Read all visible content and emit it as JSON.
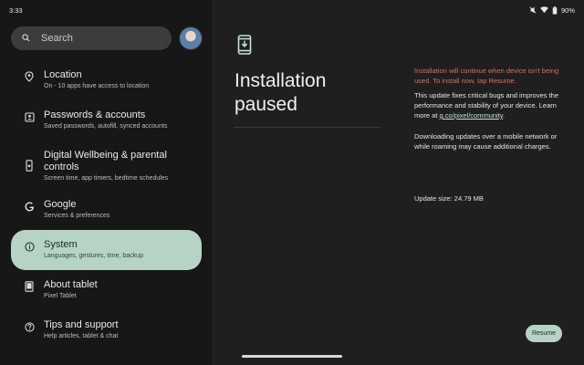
{
  "status_bar": {
    "time": "3:33",
    "battery": "90%",
    "icons": [
      "mute-icon",
      "wifi-icon",
      "battery-icon"
    ]
  },
  "search": {
    "placeholder": "Search"
  },
  "sidebar": {
    "items": [
      {
        "title": "Location",
        "subtitle": "On - 10 apps have access to location",
        "icon": "location-pin-icon"
      },
      {
        "title": "Passwords & accounts",
        "subtitle": "Saved passwords, autofill, synced accounts",
        "icon": "account-box-icon"
      },
      {
        "title": "Digital Wellbeing & parental controls",
        "subtitle": "Screen time, app timers, bedtime schedules",
        "icon": "wellbeing-icon"
      },
      {
        "title": "Google",
        "subtitle": "Services & preferences",
        "icon": "google-icon"
      },
      {
        "title": "System",
        "subtitle": "Languages, gestures, time, backup",
        "icon": "info-icon",
        "selected": true
      },
      {
        "title": "About tablet",
        "subtitle": "Pixel Tablet",
        "icon": "tablet-icon"
      },
      {
        "title": "Tips and support",
        "subtitle": "Help articles, tablet & chat",
        "icon": "help-icon"
      }
    ]
  },
  "main": {
    "title": "Installation paused",
    "warning": "Installation will continue when device isn't being used. To install now, tap Resume.",
    "description_prefix": "This update fixes critical bugs and improves the performance and stability of your device. Learn more at ",
    "description_link": "g.co/pixel/community",
    "description_suffix": ".",
    "mobile_note": "Downloading updates over a mobile network or while roaming may cause additional charges.",
    "update_size": "Update size: 24.79 MB",
    "resume_label": "Resume"
  },
  "colors": {
    "accent": "#b7d3c6",
    "warning": "#e06c5e",
    "link": "#bfe3d2"
  }
}
